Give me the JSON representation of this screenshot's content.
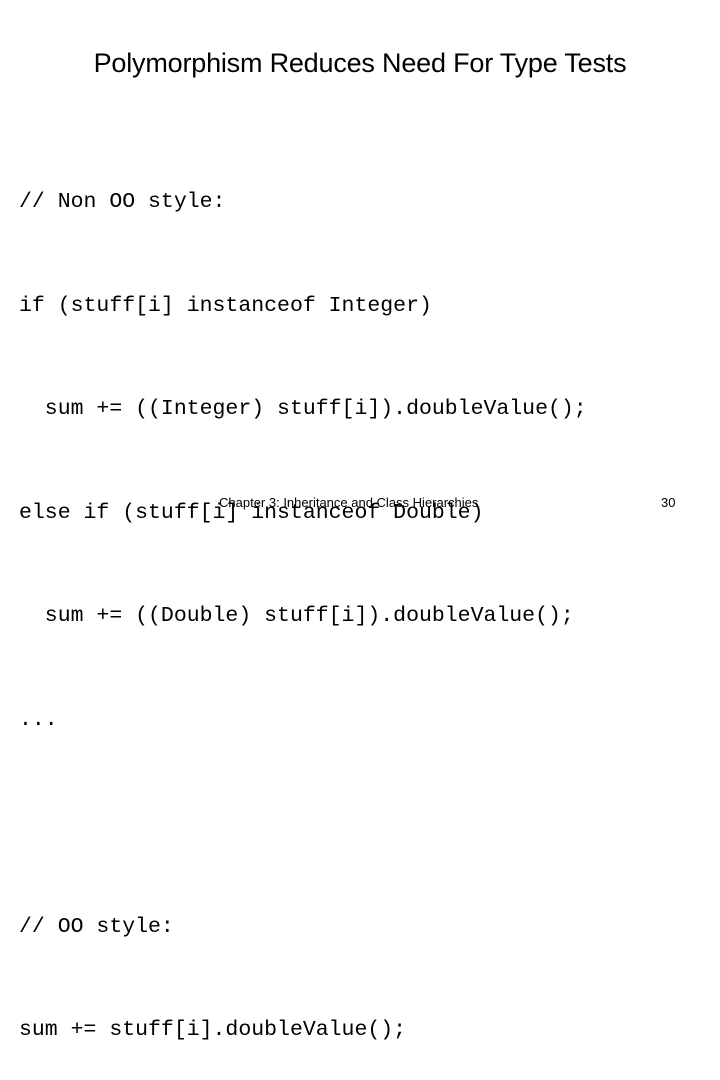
{
  "slide": {
    "title": "Polymorphism Reduces Need For Type Tests",
    "code_lines": [
      "// Non OO style:",
      "if (stuff[i] instanceof Integer)",
      "  sum += ((Integer) stuff[i]).doubleValue();",
      "else if (stuff[i] instanceof Double)",
      "  sum += ((Double) stuff[i]).doubleValue();",
      "...",
      "",
      "// OO style:",
      "sum += stuff[i].doubleValue();"
    ],
    "footer": {
      "chapter": "Chapter 3: Inheritance and Class Hierarchies",
      "page_number": "30"
    }
  }
}
